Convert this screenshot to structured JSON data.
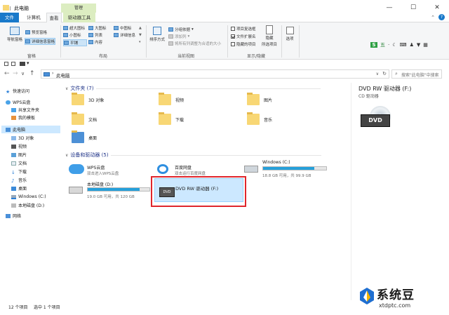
{
  "window": {
    "title": "此电脑",
    "minimize_label": "—",
    "maximize_label": "☐",
    "close_label": "✕"
  },
  "ribbon_tabs": {
    "file": "文件",
    "computer": "计算机",
    "view": "查看",
    "manage": "管理",
    "drive_tools": "驱动器工具"
  },
  "ribbon": {
    "nav_pane": "导航窗格",
    "preview_pane": "预览窗格",
    "details_pane": "详细信息窗格",
    "group_panes": "窗格",
    "xl_icons": "超大图标",
    "l_icons": "大图标",
    "m_icons": "中图标",
    "s_icons": "小图标",
    "list": "列表",
    "details": "详细信息",
    "tiles": "平铺",
    "content": "内容",
    "group_layout": "布局",
    "sort_by": "排序方式",
    "group_by": "分组依据",
    "add_columns": "添加列",
    "size_columns": "将所有列调整为合适的大小",
    "group_current_view": "当前视图",
    "item_checkboxes": "项目复选框",
    "file_ext": "文件扩展名",
    "hidden_items": "隐藏的项目",
    "hide_selected_1": "隐藏",
    "hide_selected_2": "所选项目",
    "group_show_hide": "显示/隐藏",
    "options": "选项"
  },
  "address": {
    "path": "此电脑",
    "search_placeholder": "搜索\"此电脑\"中搜索"
  },
  "sidebar": {
    "quick_access": "快速访问",
    "wps_cloud": "WPS云盘",
    "shared_folder": "共享文件夹",
    "my_templates": "我的模板",
    "this_pc": "此电脑",
    "objects3d": "3D 对象",
    "videos": "视频",
    "pictures": "图片",
    "documents": "文档",
    "downloads": "下载",
    "music": "音乐",
    "desktop": "桌面",
    "win_c": "Windows (C:)",
    "local_d": "本地磁盘 (D:)",
    "network": "网络"
  },
  "folders": {
    "header": "文件夹 (7)",
    "items": [
      "3D 对象",
      "视频",
      "图片",
      "文档",
      "下载",
      "音乐",
      "桌面"
    ]
  },
  "devices": {
    "header": "设备和驱动器 (5)",
    "wps": {
      "name": "WPS云盘",
      "sub": "双击进入WPS云盘"
    },
    "baidu": {
      "name": "百度网盘",
      "sub": "双击运行百度网盘"
    },
    "win_c": {
      "name": "Windows (C:)",
      "sub": "18.8 GB 可用，共 99.9 GB",
      "used_fraction": 0.81
    },
    "local_d": {
      "name": "本地磁盘 (D:)",
      "sub": "19.0 GB 可用，共 120 GB",
      "used_fraction": 0.84
    },
    "dvd": {
      "name": "DVD RW 驱动器 (F:)",
      "label": "DVD"
    }
  },
  "preview": {
    "title": "DVD RW 驱动器 (F:)",
    "subtitle": "CD 驱动器",
    "label": "DVD"
  },
  "status": {
    "count": "12 个项目",
    "selected": "选中 1 个项目"
  },
  "watermark": {
    "name": "系统豆",
    "url": "xtdptc.com"
  },
  "colors": {
    "accent": "#1979ca",
    "selection": "#cce8ff",
    "highlight_box": "#e0262c",
    "drive_bar": "#26a0da"
  }
}
